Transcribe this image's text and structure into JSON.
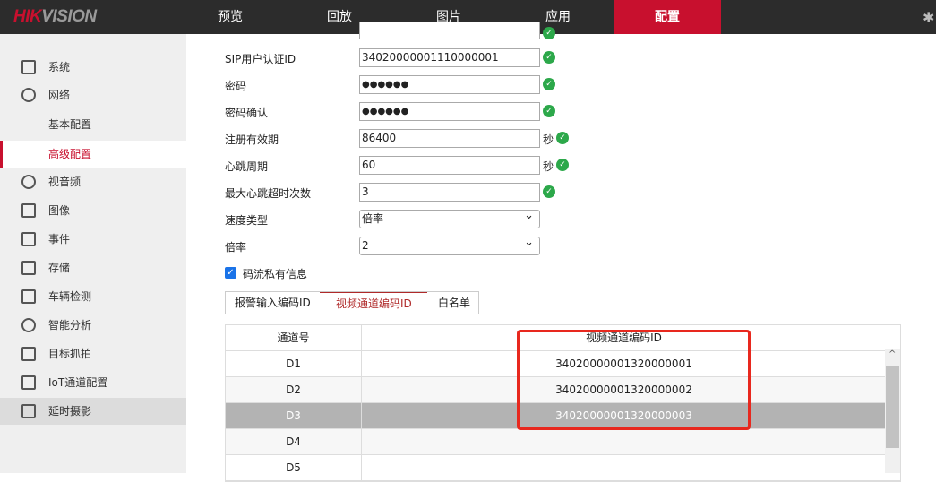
{
  "header": {
    "logo_red": "HIK",
    "logo_grey": "VISION",
    "nav": [
      "预览",
      "回放",
      "图片",
      "应用",
      "配置"
    ],
    "active": "配置"
  },
  "sidebar": {
    "items": [
      "系统",
      "网络",
      "基本配置",
      "高级配置",
      "视音频",
      "图像",
      "事件",
      "存储",
      "车辆检测",
      "智能分析",
      "目标抓拍",
      "IoT通道配置",
      "延时摄影"
    ],
    "active": "高级配置"
  },
  "form": {
    "sip_auth_label": "SIP用户认证ID",
    "sip_auth_value": "34020000001110000001",
    "password_label": "密码",
    "password_value": "●●●●●●",
    "password_confirm_label": "密码确认",
    "password_confirm_value": "●●●●●●",
    "reg_expire_label": "注册有效期",
    "reg_expire_value": "86400",
    "reg_expire_unit": "秒",
    "heartbeat_label": "心跳周期",
    "heartbeat_value": "60",
    "heartbeat_unit": "秒",
    "max_timeout_label": "最大心跳超时次数",
    "max_timeout_value": "3",
    "speed_type_label": "速度类型",
    "speed_type_value": "倍率",
    "rate_label": "倍率",
    "rate_value": "2",
    "private_info_label": "码流私有信息"
  },
  "tabs": [
    "报警输入编码ID",
    "视频通道编码ID",
    "白名单"
  ],
  "table": {
    "headers": [
      "通道号",
      "视频通道编码ID"
    ],
    "rows": [
      [
        "D1",
        "34020000001320000001"
      ],
      [
        "D2",
        "34020000001320000002"
      ],
      [
        "D3",
        "34020000001320000003"
      ],
      [
        "D4",
        ""
      ],
      [
        "D5",
        ""
      ]
    ]
  },
  "colors": {
    "accent": "#c8102e",
    "highlight": "#e8281e"
  }
}
